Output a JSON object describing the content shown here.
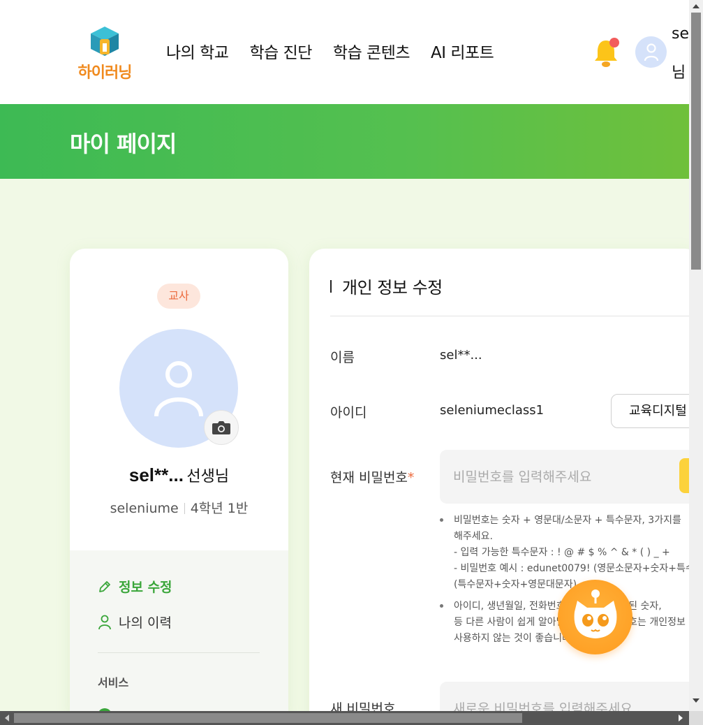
{
  "header": {
    "logo_text": "하이러닝",
    "nav": [
      "나의 학교",
      "학습 진단",
      "학습 콘텐츠",
      "AI 리포트"
    ],
    "user_name": "se",
    "user_suffix": "님"
  },
  "banner": {
    "title": "마이 페이지"
  },
  "profile": {
    "role": "교사",
    "name": "sel**...",
    "name_suffix": "선생님",
    "school": "seleniume",
    "grade_class": "4학년 1반"
  },
  "menu": {
    "edit_info": "정보 수정",
    "history": "나의 이력",
    "section_services": "서비스"
  },
  "form": {
    "title": "개인 정보 수정",
    "name_label": "이름",
    "name_value": "sel**...",
    "id_label": "아이디",
    "id_value": "seleniumeclass1",
    "edu_button": "교육디지털",
    "current_pw_label": "현재 비밀번호",
    "required_mark": "*",
    "current_pw_placeholder": "비밀번호를 입력해주세요",
    "hint1": "비밀번호는 숫자 + 영문대/소문자 + 특수문자, 3가지를\n해주세요.\n- 입력 가능한 특수문자 : ! @ # $ % ^ & * ( ) _ +\n- 비밀번호 예시 : edunet0079! (영문소문자+숫자+특수\n(특수문자+숫자+영문대문자)",
    "hint2": "아이디, 생년월일, 전화번호 등 본인과 관련된 숫자,\n등 다른 사람이 쉽게 알아낼 수 있는 비밀번호는 개인정보\n사용하지 않는 것이 좋습니다.",
    "new_pw_label": "새 비밀번호",
    "new_pw_placeholder": "새로운 비밀번호를 입력해주세요"
  },
  "colors": {
    "brand_green": "#3aa63a",
    "banner_green": "#4cbc4f",
    "accent_orange": "#ec6a3d",
    "avatar_blue": "#d5e2fa"
  }
}
